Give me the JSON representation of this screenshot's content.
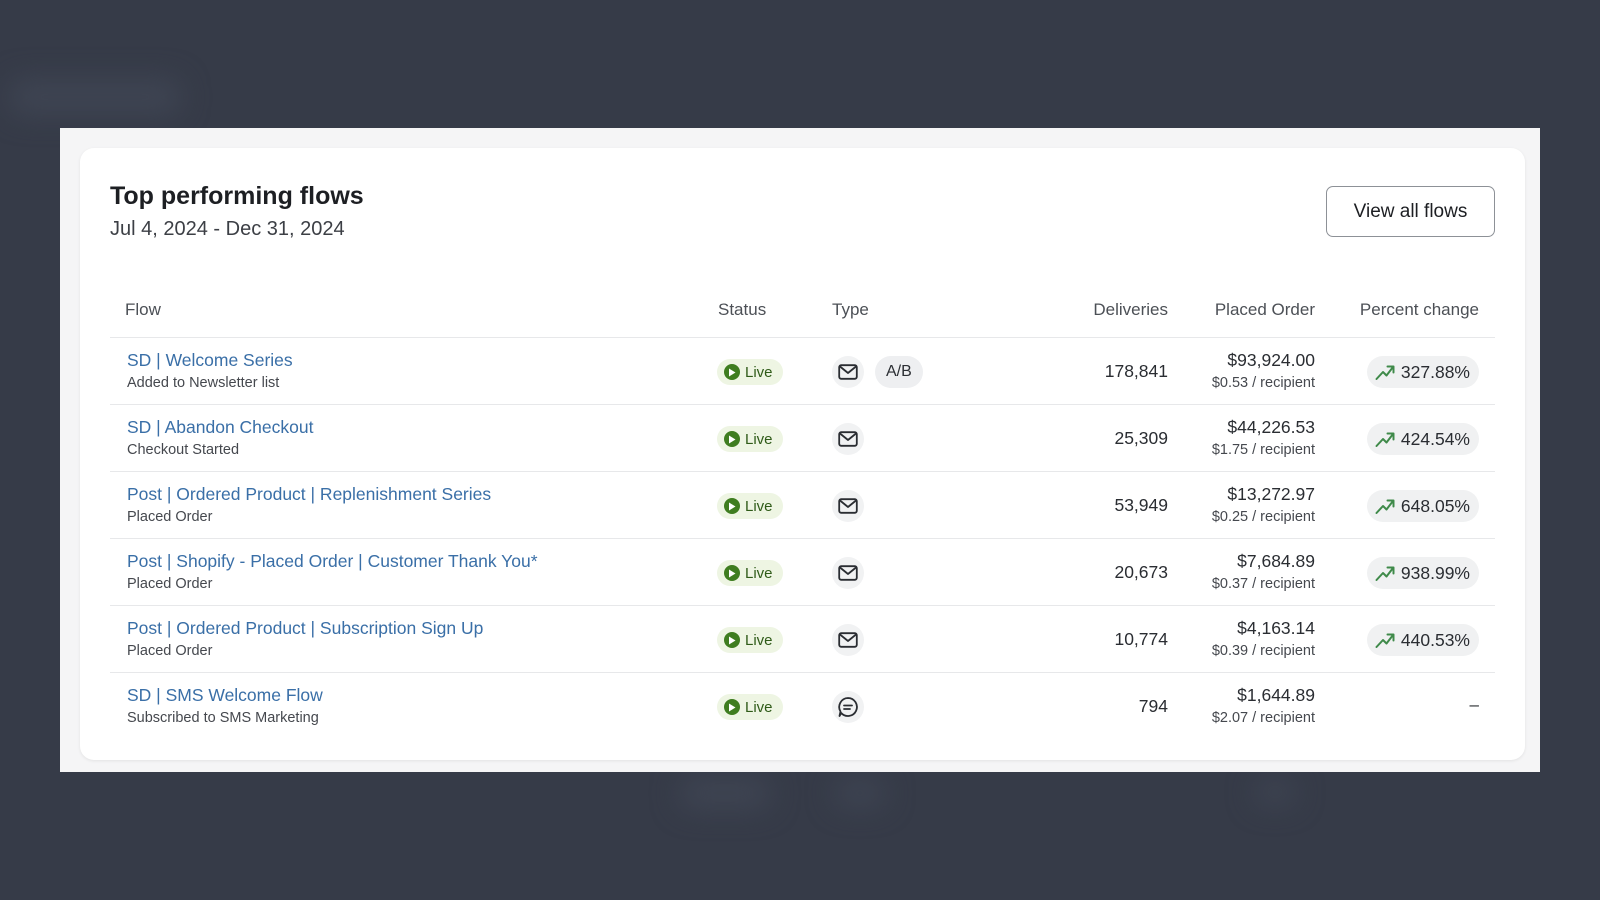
{
  "card": {
    "title": "Top performing flows",
    "date_range": "Jul 4, 2024 - Dec 31, 2024",
    "view_all_label": "View all flows"
  },
  "table": {
    "headers": {
      "flow": "Flow",
      "status": "Status",
      "type": "Type",
      "deliveries": "Deliveries",
      "placed_order": "Placed Order",
      "percent_change": "Percent change"
    },
    "rows": [
      {
        "name": "SD | Welcome Series",
        "trigger": "Added to Newsletter list",
        "status": "Live",
        "type_icon": "envelope-icon",
        "ab_label": "A/B",
        "deliveries": "178,841",
        "placed_amount": "$93,924.00",
        "per_recipient": "$0.53 / recipient",
        "percent_change": "327.88%"
      },
      {
        "name": "SD | Abandon Checkout",
        "trigger": "Checkout Started",
        "status": "Live",
        "type_icon": "envelope-icon",
        "ab_label": "",
        "deliveries": "25,309",
        "placed_amount": "$44,226.53",
        "per_recipient": "$1.75 / recipient",
        "percent_change": "424.54%"
      },
      {
        "name": "Post | Ordered Product | Replenishment Series",
        "trigger": "Placed Order",
        "status": "Live",
        "type_icon": "envelope-icon",
        "ab_label": "",
        "deliveries": "53,949",
        "placed_amount": "$13,272.97",
        "per_recipient": "$0.25 / recipient",
        "percent_change": "648.05%"
      },
      {
        "name": "Post | Shopify - Placed Order | Customer Thank You*",
        "trigger": "Placed Order",
        "status": "Live",
        "type_icon": "envelope-icon",
        "ab_label": "",
        "deliveries": "20,673",
        "placed_amount": "$7,684.89",
        "per_recipient": "$0.37 / recipient",
        "percent_change": "938.99%"
      },
      {
        "name": "Post | Ordered Product | Subscription Sign Up",
        "trigger": "Placed Order",
        "status": "Live",
        "type_icon": "envelope-icon",
        "ab_label": "",
        "deliveries": "10,774",
        "placed_amount": "$4,163.14",
        "per_recipient": "$0.39 / recipient",
        "percent_change": "440.53%"
      },
      {
        "name": "SD | SMS Welcome Flow",
        "trigger": "Subscribed to SMS Marketing",
        "status": "Live",
        "type_icon": "sms-chat-icon",
        "ab_label": "",
        "deliveries": "794",
        "placed_amount": "$1,644.89",
        "per_recipient": "$2.07 / recipient",
        "percent_change": "–"
      }
    ]
  },
  "colors": {
    "page_background": "#363b48",
    "link": "#3a6fa7",
    "live_pill_bg": "#eef5e3",
    "live_dot": "#3f7d20",
    "trend_up": "#3f8a4a"
  }
}
